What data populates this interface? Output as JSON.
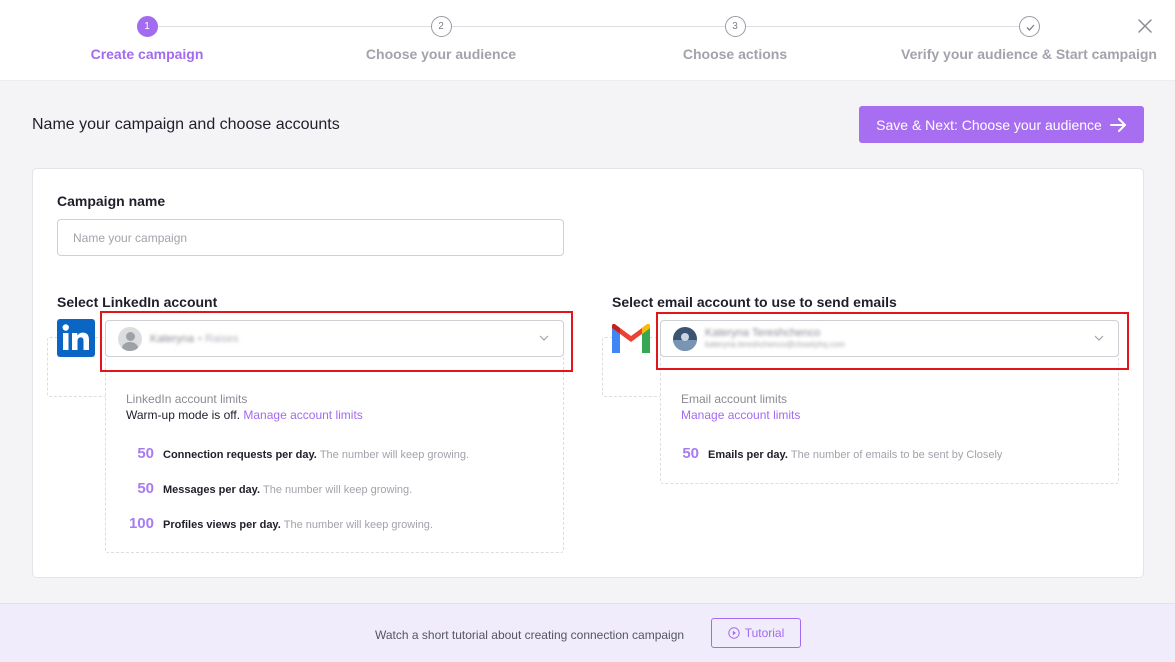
{
  "stepper": {
    "steps": [
      {
        "number": "1",
        "label": "Create campaign"
      },
      {
        "number": "2",
        "label": "Choose your audience"
      },
      {
        "number": "3",
        "label": "Choose actions"
      },
      {
        "number": "",
        "label": "Verify your audience & Start campaign"
      }
    ]
  },
  "header": {
    "title": "Name your campaign and choose accounts",
    "next_button": "Save & Next: Choose your audience"
  },
  "campaign": {
    "label": "Campaign name",
    "value": "",
    "placeholder": "Name your campaign"
  },
  "linkedin": {
    "label": "Select LinkedIn account",
    "selected_name": "Kateryna",
    "selected_extra": "• Raises",
    "limits_title": "LinkedIn account limits",
    "warmup_text": "Warm-up mode is off.",
    "manage_link": "Manage account limits",
    "limits": [
      {
        "value": "50",
        "name": "Connection requests per day.",
        "desc": "The number will keep growing."
      },
      {
        "value": "50",
        "name": "Messages per day.",
        "desc": "The number will keep growing."
      },
      {
        "value": "100",
        "name": "Profiles views per day.",
        "desc": "The number will keep growing."
      }
    ]
  },
  "email": {
    "label": "Select email account to use to send emails",
    "selected_name": "Kateryna Tereshchenco",
    "selected_address": "kateryna.tereshchenco@closelyhq.com",
    "limits_title": "Email account limits",
    "manage_link": "Manage account limits",
    "limits": [
      {
        "value": "50",
        "name": "Emails per day.",
        "desc": "The number of emails to be sent by Closely"
      }
    ]
  },
  "footer": {
    "text": "Watch a short tutorial about creating connection campaign",
    "tutorial_button": "Tutorial"
  },
  "colors": {
    "accent": "#a26bf0",
    "button": "#a86ef2",
    "highlight": "#e2161a",
    "linkedin": "#0a66c2"
  }
}
